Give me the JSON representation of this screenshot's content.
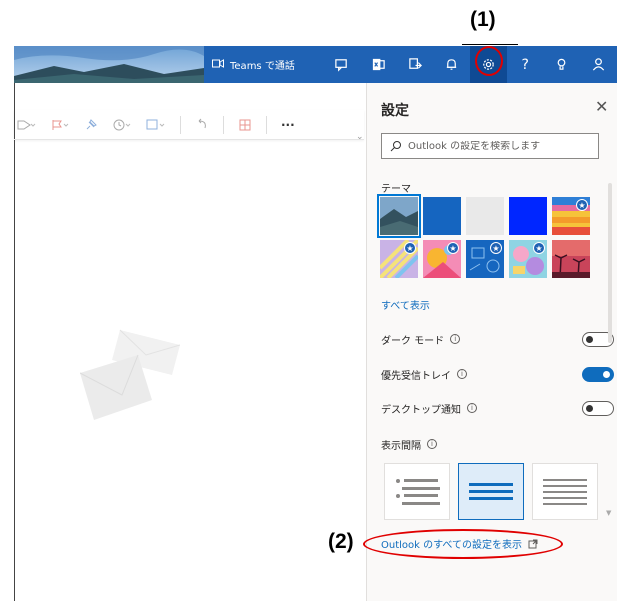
{
  "annotations": {
    "one": "(1)",
    "two": "(2)"
  },
  "topbar": {
    "teams_label": "Teams で通話",
    "icons": [
      "camera-icon",
      "chat-icon",
      "sheets-icon",
      "share-icon",
      "bell-icon",
      "gear-icon",
      "help-icon",
      "tips-icon",
      "person-icon"
    ],
    "help_glyph": "?"
  },
  "toolbar": {
    "items": [
      "tag-icon",
      "flag-icon",
      "pin-icon",
      "clock-icon",
      "move-icon",
      "undo-icon",
      "apps-icon",
      "more-icon"
    ],
    "more_glyph": "···"
  },
  "settings": {
    "title": "設定",
    "close_glyph": "✕",
    "search_placeholder": "Outlook の設定を検索します",
    "theme_label": "テーマ",
    "show_all": "すべて表示",
    "dark_mode": {
      "label": "ダーク モード",
      "on": false
    },
    "focused_inbox": {
      "label": "優先受信トレイ",
      "on": true
    },
    "desktop_notify": {
      "label": "デスクトップ通知",
      "on": false
    },
    "display_density_label": "表示間隔",
    "info_glyph": "i",
    "all_settings_link": "Outlook のすべての設定を表示",
    "themes": [
      {
        "name": "landscape",
        "selected": true,
        "star": false
      },
      {
        "name": "blue",
        "selected": false,
        "star": false
      },
      {
        "name": "light-gray",
        "selected": false,
        "star": false
      },
      {
        "name": "bright-blue",
        "selected": false,
        "star": false
      },
      {
        "name": "rainbow",
        "selected": false,
        "star": true
      },
      {
        "name": "colorful-lines",
        "selected": false,
        "star": true
      },
      {
        "name": "pink-orange",
        "selected": false,
        "star": true
      },
      {
        "name": "blue-doodle",
        "selected": false,
        "star": true
      },
      {
        "name": "pastel-art",
        "selected": false,
        "star": true
      },
      {
        "name": "sunset-palms",
        "selected": false,
        "star": false
      }
    ],
    "densities": [
      "full",
      "medium",
      "compact"
    ],
    "selected_density": "medium"
  },
  "colors": {
    "accent": "#0f6cbd",
    "topbar": "#1f62b4",
    "annotation_red": "#e00000"
  }
}
